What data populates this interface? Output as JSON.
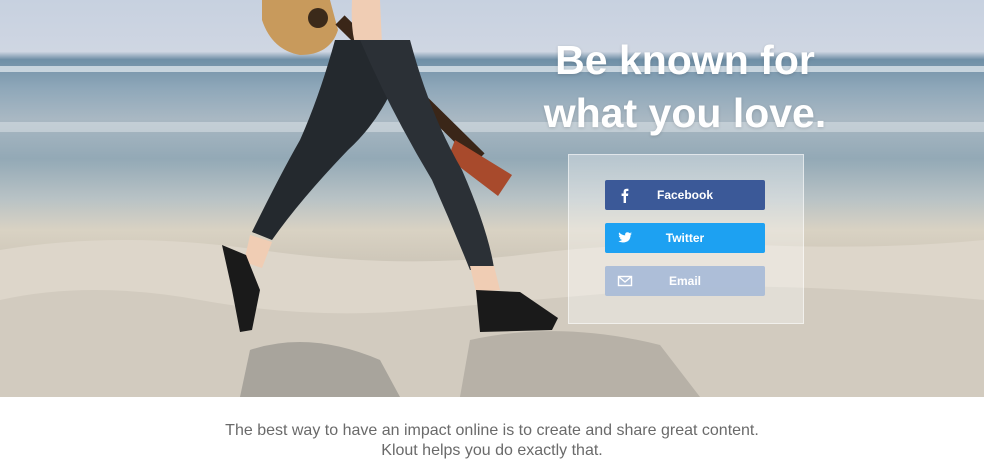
{
  "hero": {
    "headline_line1": "Be known for",
    "headline_line2": "what you love."
  },
  "signup": {
    "buttons": [
      {
        "label": "Facebook",
        "icon": "facebook-icon",
        "color": "#3b5998"
      },
      {
        "label": "Twitter",
        "icon": "twitter-icon",
        "color": "#1da1f2"
      },
      {
        "label": "Email",
        "icon": "mail-icon",
        "color": "#aabcd7"
      }
    ]
  },
  "footer": {
    "tagline_line1": "The best way to have an impact online is to create and share great content.",
    "tagline_line2": "Klout helps you do exactly that."
  }
}
